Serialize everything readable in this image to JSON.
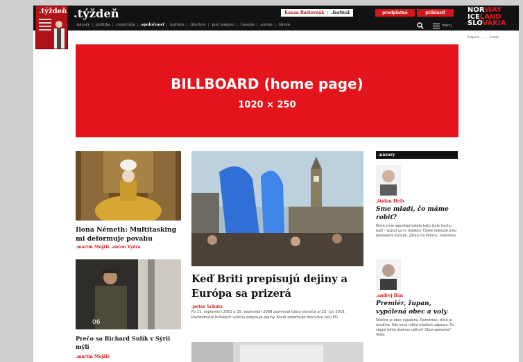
{
  "header": {
    "cover_title": ".týždeň",
    "brand": ".týždeň",
    "nav": [
      ".názory",
      ".politika",
      ".reportáže",
      ".spoločnosť",
      ".kultúra",
      ".lifestyle",
      ".pod lampou",
      ".časopis",
      ".eshop",
      ".fórum"
    ],
    "tag_left": "Kauza Bašternák",
    "tag_right": ".festival",
    "subscribe": "predplatné",
    "login": "prihlásiť",
    "menu_label": "menu",
    "partner_lines": [
      "NOR",
      "WAY",
      "ICE",
      "LAND",
      "SLO",
      "VAKIA"
    ],
    "partner_note": "Podporil: ......... Granty"
  },
  "billboard": {
    "title": "BILLBOARD (home page)",
    "size": "1020 × 250"
  },
  "articles": {
    "a1": {
      "title": "Ilona Németh: Multitasking mi deformuje povahu",
      "authors": ".martin Mojžiš .anton Vydra"
    },
    "a2": {
      "title": "Prečo sa Richard Sulík v Sýrii mýli",
      "authors": ".martin Mojžiš",
      "badge": "06"
    },
    "main": {
      "title": "Keď Briti prepisujú dejiny a Európa sa prizerá",
      "author": ".peter Schutz",
      "excerpt": "Po 11. septembri 2001 a 15. septembri 2008 zaznievaí tobto storočia aj 23. jún 2016. Rozhodnutie britských voličov prepisuje dejiny. Ktoré redefinuje dovnútra celú EÚ."
    }
  },
  "opinions": {
    "heading": ".názory",
    "items": [
      {
        "author": ".štefan Hríb",
        "title": "Sme mladí, čo máme robiť?",
        "text": "Ktoré zmie napríklad takéto tejto štýle trochu baží – spýtal sa mi redaktor České televizie pred prepiekom Kancen. Zýtalo na Potoriu. Stalostiou"
      },
      {
        "author": ".andrej Bán",
        "title": "Premiér, župan, vypálená obec a voly",
        "text": "Šťastne je obec vypalena. Raznorzak, štátu je úradíma. Kde býva nižšia mladých zápasov. Čo stagie tohto úkolnou odítne? Obce spoločne? Veda."
      }
    ]
  },
  "colors": {
    "accent": "#d4161c",
    "bar": "#121212"
  }
}
